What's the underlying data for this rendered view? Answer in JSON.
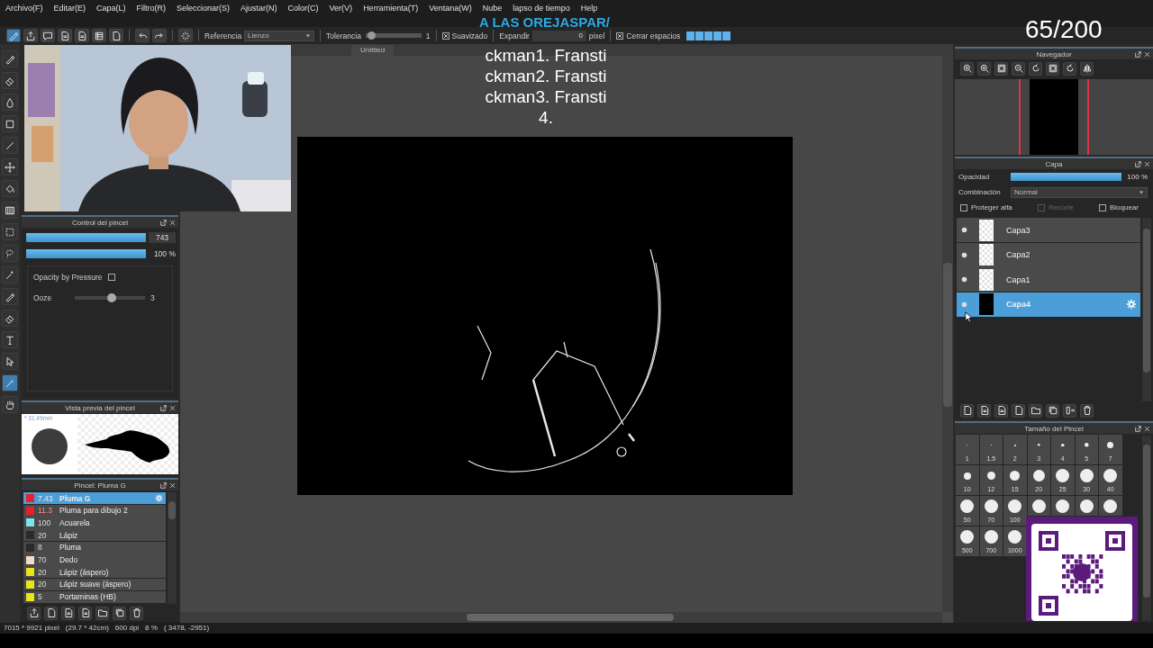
{
  "menu": [
    "Archivo(F)",
    "Editar(E)",
    "Capa(L)",
    "Filtro(R)",
    "Seleccionar(S)",
    "Ajustar(N)",
    "Color(C)",
    "Ver(V)",
    "Herramienta(T)",
    "Ventana(W)",
    "Nube",
    "lapso de tiempo",
    "Help"
  ],
  "toolbar": {
    "reference": {
      "label": "Referencia",
      "value": "Lienzo"
    },
    "tolerance": {
      "label": "Tolerancia",
      "level": 0.03,
      "value": "1"
    },
    "smoothing": {
      "label": "Suavizado",
      "checked": true
    },
    "expand": {
      "label": "Expandir",
      "value": "0",
      "unit": "pixel"
    },
    "close_gaps": {
      "label": "Cerrar espacios",
      "checked": true
    }
  },
  "overlay": {
    "ticker": "A LAS OREJASPAR/",
    "counter": "65/200",
    "lines": [
      "ckman1. Fransti",
      "ckman2. Fransti",
      "ckman3. Fransti",
      "4."
    ]
  },
  "document_tab": "Untitled",
  "brush_control": {
    "title": "Control del pincel",
    "size": {
      "level": 1,
      "value": "743"
    },
    "opacity": {
      "level": 1,
      "value": "100 %"
    },
    "pressure": {
      "label": "Opacity by Pressure",
      "checked": false
    },
    "ooze": {
      "label": "Ooze",
      "level": 0.52,
      "value": "3"
    }
  },
  "brush_preview": {
    "title": "Vista previa del pincel",
    "size": "* 31.49mm"
  },
  "brushes": {
    "title": "Pincel: Pluma G",
    "items": [
      {
        "color": "#e8202a",
        "size": "7.43",
        "size_alert": true,
        "name": "Pluma G",
        "selected": true
      },
      {
        "color": "#e8202a",
        "size": "11.3",
        "size_alert": true,
        "name": "Pluma para dibujo 2",
        "selected": false
      },
      {
        "color": "#7fe3f0",
        "size": "100",
        "size_alert": false,
        "name": "Acuarela",
        "selected": false
      },
      {
        "color": "#2a2a2a",
        "size": "20",
        "size_alert": false,
        "name": "Lápiz",
        "selected": false
      },
      {
        "color": "#2a2a2a",
        "size": "8",
        "size_alert": false,
        "name": "Pluma",
        "selected": false
      },
      {
        "color": "#f5dcc8",
        "size": "70",
        "size_alert": false,
        "name": "Dedo",
        "selected": false
      },
      {
        "color": "#e6e619",
        "size": "20",
        "size_alert": false,
        "name": "Lápiz (áspero)",
        "selected": false
      },
      {
        "color": "#e6e619",
        "size": "20",
        "size_alert": false,
        "name": "Lápiz suave (áspero)",
        "selected": false
      },
      {
        "color": "#e6e619",
        "size": "5",
        "size_alert": false,
        "name": "Portaminas (HB)",
        "selected": false
      }
    ]
  },
  "navigator": {
    "title": "Navegador"
  },
  "layers": {
    "title": "Capa",
    "opacity": {
      "label": "Opacidad",
      "level": 1,
      "value": "100 %"
    },
    "blend": {
      "label": "Combinación",
      "value": "Normal"
    },
    "options": [
      {
        "label": "Proteger alfa",
        "checked": false,
        "disabled": false
      },
      {
        "label": "Recorte",
        "checked": false,
        "disabled": true
      },
      {
        "label": "Bloquear",
        "checked": false,
        "disabled": false
      }
    ],
    "items": [
      {
        "name": "Capa3",
        "has_content": false,
        "selected": false
      },
      {
        "name": "Capa2",
        "has_content": false,
        "selected": false
      },
      {
        "name": "Capa1",
        "has_content": false,
        "selected": false
      },
      {
        "name": "Capa4",
        "has_content": true,
        "selected": true
      }
    ]
  },
  "brush_sizes": {
    "title": "Tamaño del Pincel",
    "rows": [
      [
        {
          "label": "1"
        },
        {
          "label": "1.5"
        },
        {
          "label": "2"
        },
        {
          "label": "3"
        },
        {
          "label": "4"
        },
        {
          "label": "5"
        },
        {
          "label": "7"
        }
      ],
      [
        {
          "label": "10"
        },
        {
          "label": "12"
        },
        {
          "label": "15"
        },
        {
          "label": "20"
        },
        {
          "label": "25"
        },
        {
          "label": "30"
        },
        {
          "label": "40"
        }
      ],
      [
        {
          "label": "50"
        },
        {
          "label": "70"
        },
        {
          "label": "100"
        },
        {},
        {},
        {},
        {}
      ],
      [
        {
          "label": "500"
        },
        {
          "label": "700"
        },
        {
          "label": "1000"
        }
      ]
    ]
  },
  "status": [
    "7015 * 9921 pixel",
    "(29.7 * 42cm)",
    "600 dpi",
    "8 %",
    "( 3478, -2951)"
  ]
}
